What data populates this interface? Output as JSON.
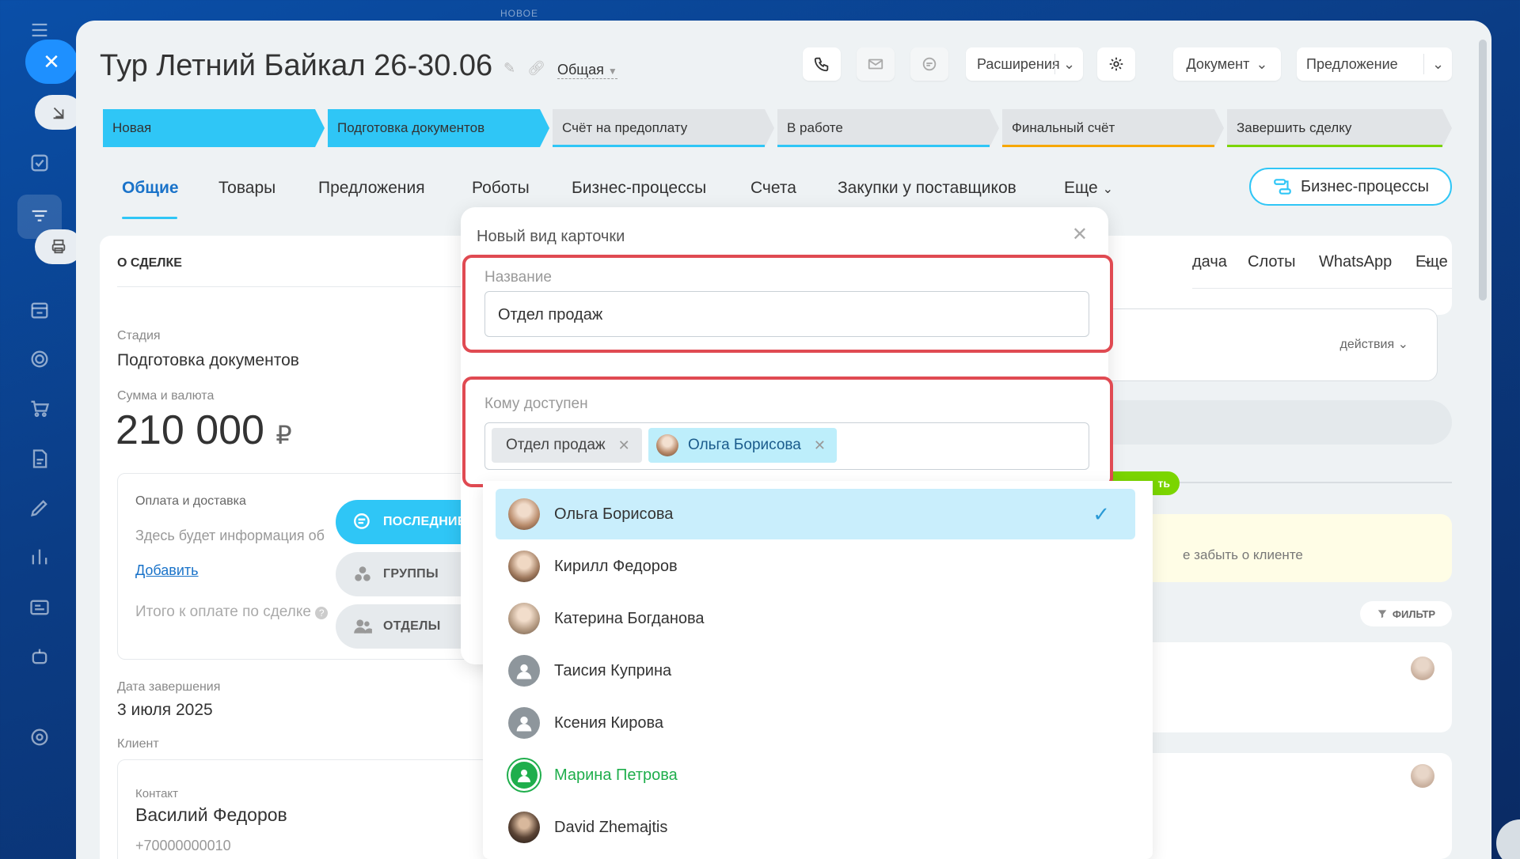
{
  "rail": {
    "new_label": "НОВОЕ"
  },
  "header": {
    "title": "Тур Летний Байкал 26-30.06",
    "category": "Общая",
    "extensions_label": "Расширения",
    "document_label": "Документ",
    "offer_label": "Предложение"
  },
  "stages": [
    {
      "label": "Новая",
      "color": "#2fc6f6"
    },
    {
      "label": "Подготовка документов",
      "color": "#2fc6f6"
    },
    {
      "label": "Счёт на предоплату",
      "color": "#2fc6f6"
    },
    {
      "label": "В работе",
      "color": "#2fc6f6"
    },
    {
      "label": "Финальный счёт",
      "color": "#f7a700"
    },
    {
      "label": "Завершить сделку",
      "color": "#7bd500"
    }
  ],
  "tabs": [
    "Общие",
    "Товары",
    "Предложения",
    "Роботы",
    "Бизнес-процессы",
    "Счета",
    "Закупки у поставщиков",
    "Еще"
  ],
  "bp_button": "Бизнес-процессы",
  "deal": {
    "section_title": "О СДЕЛКЕ",
    "stage_label": "Стадия",
    "stage_value": "Подготовка документов",
    "sum_label": "Сумма и валюта",
    "sum_value": "210 000",
    "currency": "₽",
    "pay_title": "Оплата и доставка",
    "pay_info": "Здесь будет информация об",
    "add_link": "Добавить",
    "total_label": "Итого к оплате по сделке",
    "close_date_label": "Дата завершения",
    "close_date_value": "3 июля 2025",
    "client_label": "Клиент",
    "contact_label": "Контакт",
    "contact_name": "Василий Федоров",
    "contact_phone": "+70000000010"
  },
  "right": {
    "tabs": [
      "дача",
      "Слоты",
      "WhatsApp",
      "Еще"
    ],
    "actions_label": "действия",
    "green_btn": "ть",
    "note_text": "е забыть о клиенте",
    "filter_label": "ФИЛЬТР"
  },
  "selector_tabs": [
    "ПОСЛЕДНИЕ",
    "ГРУППЫ",
    "ОТДЕЛЫ"
  ],
  "modal": {
    "title": "Новый вид карточки",
    "name_label": "Название",
    "name_value": "Отдел продаж",
    "access_label": "Кому доступен",
    "chips": [
      "Отдел продаж",
      "Ольга Борисова"
    ]
  },
  "people": [
    {
      "name": "Ольга Борисова",
      "selected": true
    },
    {
      "name": "Кирилл Федоров",
      "selected": false
    },
    {
      "name": "Катерина Богданова",
      "selected": false
    },
    {
      "name": "Таисия Куприна",
      "selected": false
    },
    {
      "name": "Ксения Кирова",
      "selected": false
    },
    {
      "name": "Марина Петрова",
      "selected": false,
      "color": "#1fae4c"
    },
    {
      "name": "David Zhemajtis",
      "selected": false
    }
  ]
}
